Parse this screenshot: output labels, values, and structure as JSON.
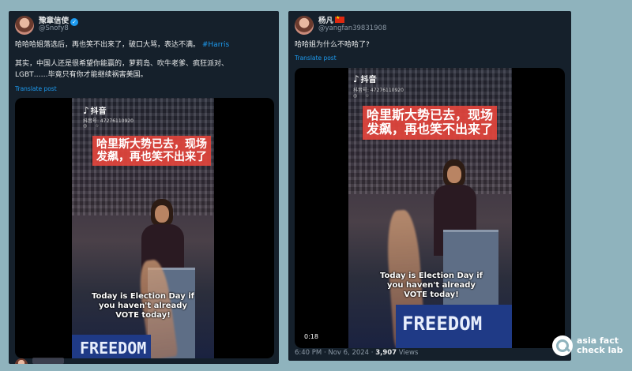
{
  "left_post": {
    "display_name": "豫章信使",
    "handle": "@Snofy8",
    "text_line1": "哈哈哈姐落选后，再也笑不出来了，破口大骂，表达不满。",
    "hashtag": "#Harris",
    "text_line2": "其实，中国人还是很希望你能赢的，萝莉岛、吹牛老爹、疯狂派对、",
    "text_line3": "LGBT……毕竟只有你才能继续祸害美国。",
    "translate": "Translate post",
    "video": {
      "app_name": "抖音",
      "douyin_id": "抖音号: 47276110920",
      "headline_line1": "哈里斯大势已去，现场",
      "headline_line2": "发飙，再也笑不出来了",
      "subtitle_line1": "Today is Election Day if",
      "subtitle_line2": "you haven't already",
      "subtitle_line3": "VOTE today!",
      "banner": "FREEDOM"
    }
  },
  "right_post": {
    "display_name": "杨凡",
    "handle": "@yangfan39831908",
    "text": "哈哈姐为什么不哈哈了?",
    "translate": "Translate post",
    "video": {
      "app_name": "抖音",
      "douyin_id": "抖音号: 47276110920",
      "headline_line1": "哈里斯大势已去，现场",
      "headline_line2": "发飙，再也笑不出来了",
      "subtitle_line1": "Today is Election Day if",
      "subtitle_line2": "you haven't already",
      "subtitle_line3": "VOTE today!",
      "banner": "FREEDOM",
      "duration": "0:18"
    },
    "timestamp": "6:40 PM · Nov 6, 2024 · ",
    "views_count": "3,907",
    "views_label": " Views"
  },
  "brand": {
    "line1": "asia fact",
    "line2": "check lab"
  },
  "colors": {
    "background": "#8fb3bd",
    "post_bg": "#15202b",
    "link": "#1d9bf0",
    "headline_bg": "#e2443c"
  }
}
